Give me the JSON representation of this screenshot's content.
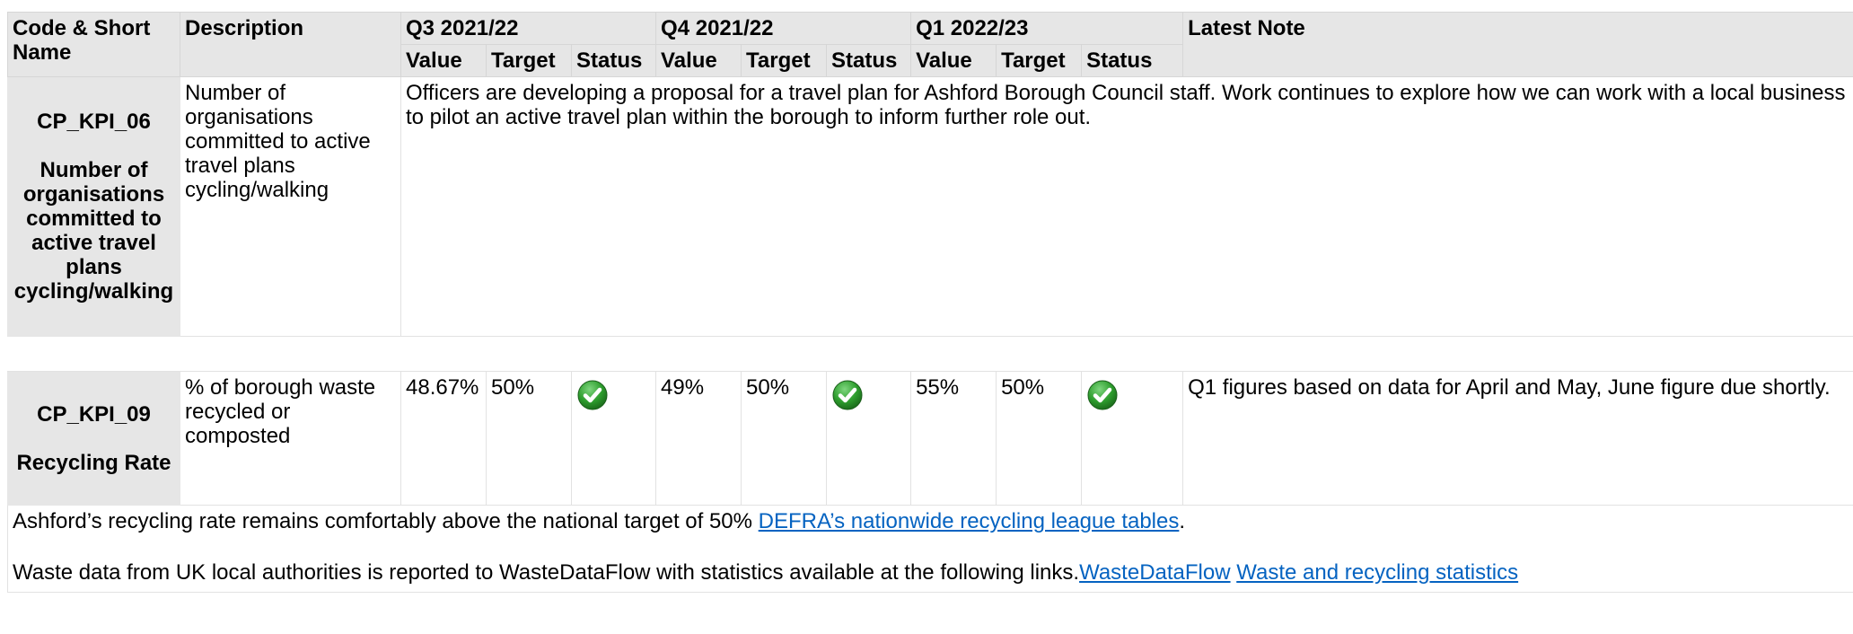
{
  "headers": {
    "code_name": "Code & Short Name",
    "description": "Description",
    "latest_note": "Latest Note",
    "quarters": [
      "Q3 2021/22",
      "Q4 2021/22",
      "Q1 2022/23"
    ],
    "sub": {
      "value": "Value",
      "target": "Target",
      "status": "Status"
    }
  },
  "rows": [
    {
      "code": "CP_KPI_06",
      "short_name": "Number of organisations committed to active travel plans cycling/walking",
      "description": "Number of organisations committed to active travel plans cycling/walking",
      "note": "Officers are developing a proposal for a travel plan for Ashford Borough Council staff. Work continues to explore how we can work with a local business to pilot an active travel plan within the borough to inform further role out."
    },
    {
      "code": "CP_KPI_09",
      "short_name": "Recycling Rate",
      "description": "% of borough waste recycled or composted",
      "quarters": [
        {
          "value": "48.67%",
          "target": "50%",
          "status": "achieved-icon"
        },
        {
          "value": "49%",
          "target": "50%",
          "status": "achieved-icon"
        },
        {
          "value": "55%",
          "target": "50%",
          "status": "achieved-icon"
        }
      ],
      "note": "Q1 figures based on data for April and May, June figure due shortly."
    }
  ],
  "extended_note": {
    "line1_text": "Ashford’s recycling rate remains comfortably above the national target of 50% ",
    "line1_link": "DEFRA’s nationwide recycling league tables",
    "line1_end": ".",
    "line2_text": "Waste data from UK local authorities is reported to WasteDataFlow with statistics available at the following links.",
    "line2_link1": "WasteDataFlow",
    "line2_link2": "Waste and recycling statistics"
  },
  "colors": {
    "header_bg": "#e6e6e6",
    "link": "#0563c1",
    "status_green": "#2e9e2e"
  }
}
